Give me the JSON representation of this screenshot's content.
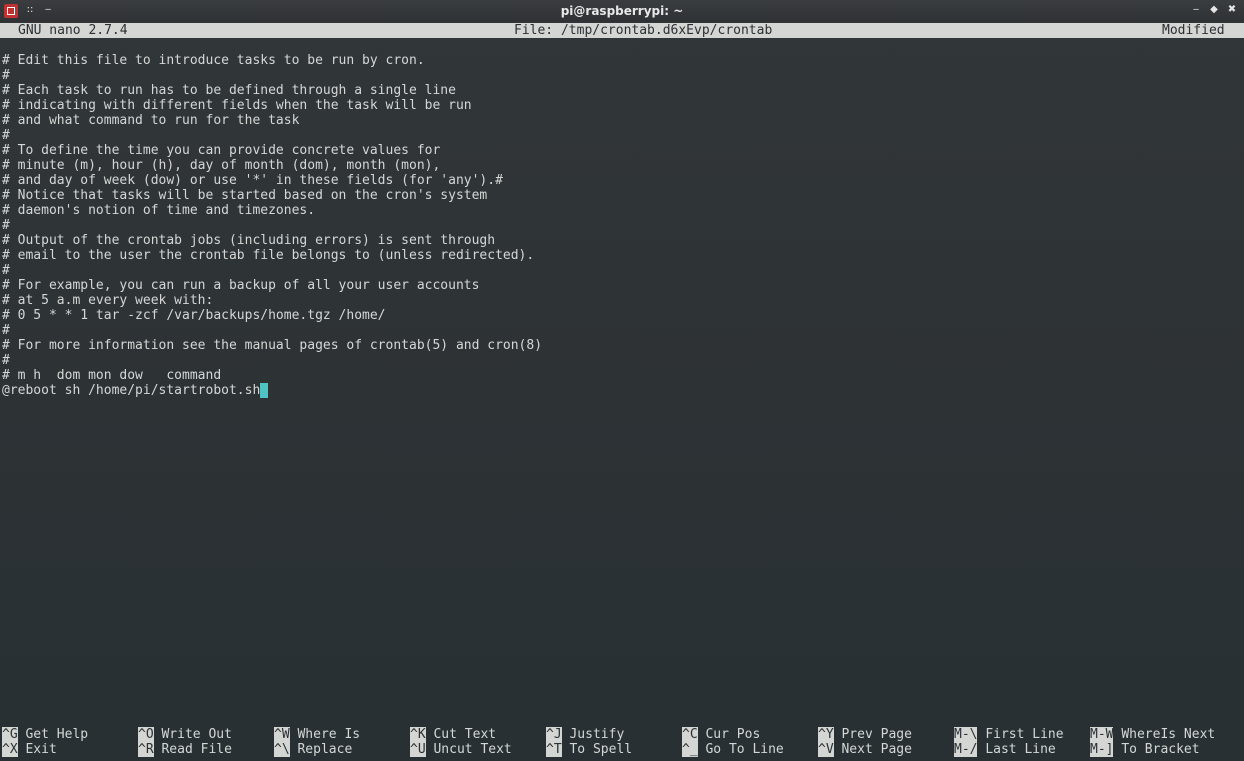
{
  "window": {
    "title": "pi@raspberrypi: ~",
    "app_icon": "terminal-icon",
    "menu_glyph": "::",
    "pin_glyph": "‒",
    "minimize_glyph": "‒",
    "maximize_glyph": "◆",
    "close_glyph": "✖"
  },
  "nano": {
    "version": "GNU nano 2.7.4",
    "file": "File: /tmp/crontab.d6xEvp/crontab",
    "status": "Modified"
  },
  "editor": {
    "lines": [
      "# Edit this file to introduce tasks to be run by cron.",
      "#",
      "# Each task to run has to be defined through a single line",
      "# indicating with different fields when the task will be run",
      "# and what command to run for the task",
      "#",
      "# To define the time you can provide concrete values for",
      "# minute (m), hour (h), day of month (dom), month (mon),",
      "# and day of week (dow) or use '*' in these fields (for 'any').#",
      "# Notice that tasks will be started based on the cron's system",
      "# daemon's notion of time and timezones.",
      "#",
      "# Output of the crontab jobs (including errors) is sent through",
      "# email to the user the crontab file belongs to (unless redirected).",
      "#",
      "# For example, you can run a backup of all your user accounts",
      "# at 5 a.m every week with:",
      "# 0 5 * * 1 tar -zcf /var/backups/home.tgz /home/",
      "#",
      "# For more information see the manual pages of crontab(5) and cron(8)",
      "#",
      "# m h  dom mon dow   command"
    ],
    "current_line": "@reboot sh /home/pi/startrobot.sh"
  },
  "shortcuts": [
    [
      {
        "key": "^G",
        "label": "Get Help"
      },
      {
        "key": "^X",
        "label": "Exit"
      }
    ],
    [
      {
        "key": "^O",
        "label": "Write Out"
      },
      {
        "key": "^R",
        "label": "Read File"
      }
    ],
    [
      {
        "key": "^W",
        "label": "Where Is"
      },
      {
        "key": "^\\",
        "label": "Replace"
      }
    ],
    [
      {
        "key": "^K",
        "label": "Cut Text"
      },
      {
        "key": "^U",
        "label": "Uncut Text"
      }
    ],
    [
      {
        "key": "^J",
        "label": "Justify"
      },
      {
        "key": "^T",
        "label": "To Spell"
      }
    ],
    [
      {
        "key": "^C",
        "label": "Cur Pos"
      },
      {
        "key": "^_",
        "label": "Go To Line"
      }
    ],
    [
      {
        "key": "^Y",
        "label": "Prev Page"
      },
      {
        "key": "^V",
        "label": "Next Page"
      }
    ],
    [
      {
        "key": "M-\\",
        "label": "First Line"
      },
      {
        "key": "M-/",
        "label": "Last Line"
      }
    ],
    [
      {
        "key": "M-W",
        "label": "WhereIs Next"
      },
      {
        "key": "M-]",
        "label": "To Bracket"
      }
    ]
  ]
}
